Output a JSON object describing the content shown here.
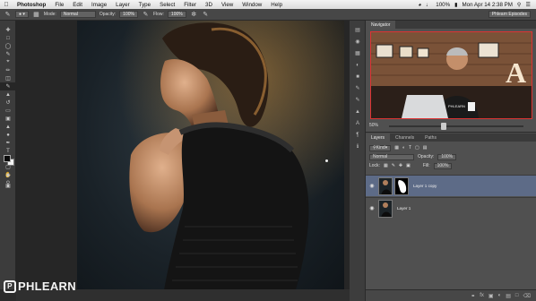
{
  "menubar": {
    "items": [
      "Photoshop",
      "File",
      "Edit",
      "Image",
      "Layer",
      "Type",
      "Select",
      "Filter",
      "3D",
      "View",
      "Window",
      "Help"
    ],
    "date_time": "Mon Apr 14  2:38 PM",
    "battery": "100%"
  },
  "options": {
    "mode_label": "Mode:",
    "mode_value": "Normal",
    "opacity_label": "Opacity:",
    "opacity_value": "100%",
    "flow_label": "Flow:",
    "flow_value": "100%",
    "workspace": "Phlearn Episodes"
  },
  "navigator": {
    "tabs": [
      "Navigator"
    ],
    "zoom": "50%",
    "preview_text": "PHLEARN",
    "preview_letter": "A"
  },
  "layers": {
    "tabs": [
      "Layers",
      "Channels",
      "Paths"
    ],
    "kind_label": "Kind",
    "blend_mode": "Normal",
    "opacity_label": "Opacity:",
    "opacity_value": "100%",
    "lock_label": "Lock:",
    "fill_label": "Fill:",
    "fill_value": "100%",
    "items": [
      {
        "name": "Layer 1 copy",
        "selected": true
      },
      {
        "name": "Layer 1",
        "selected": false
      }
    ]
  },
  "watermark": {
    "brand": "PHLEARN",
    "badge": "P"
  },
  "colors": {
    "selection": "#5d6b87",
    "panel": "#505050",
    "menubar": "#e6e6e6"
  }
}
